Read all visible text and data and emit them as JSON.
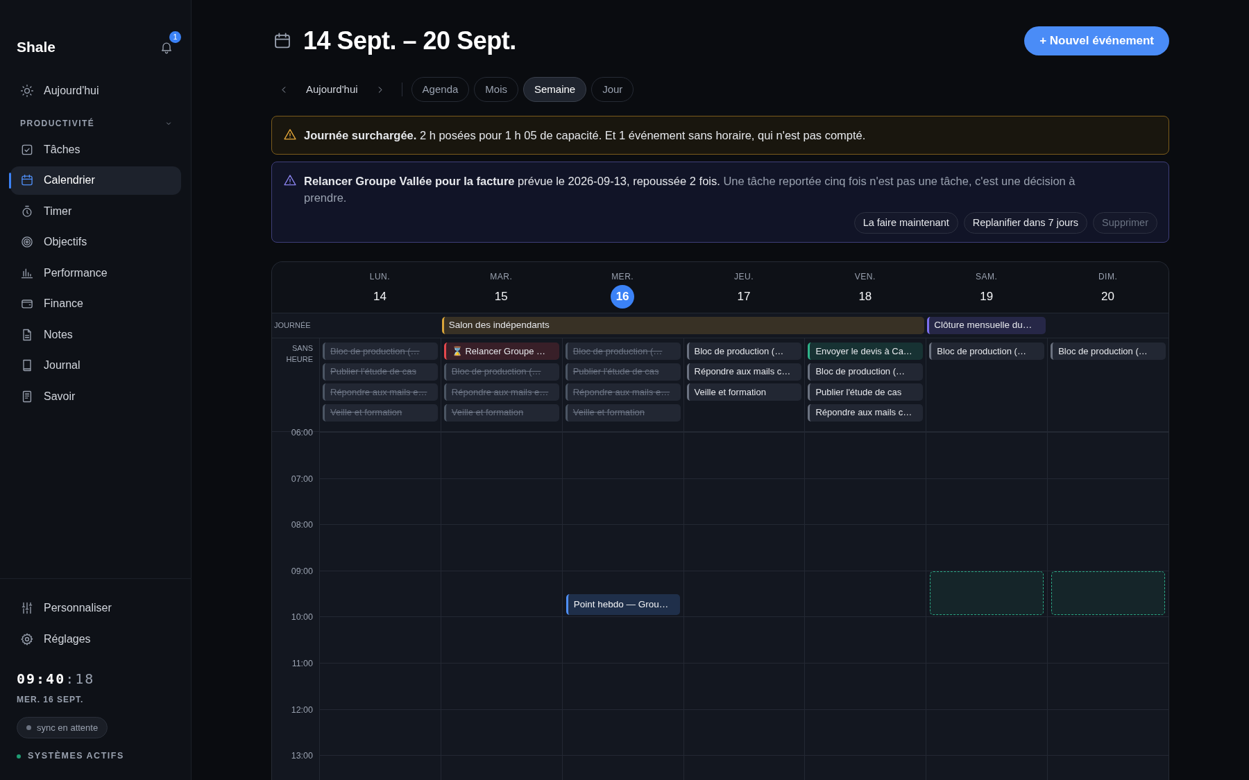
{
  "sidebar": {
    "brand": "Shale",
    "notification_count": "1",
    "top_items": [
      {
        "label": "Aujourd'hui",
        "selected": false
      }
    ],
    "section": {
      "title": "PRODUCTIVITÉ",
      "expanded": true,
      "items": [
        {
          "label": "Tâches",
          "selected": false
        },
        {
          "label": "Calendrier",
          "selected": true
        },
        {
          "label": "Timer",
          "selected": false
        },
        {
          "label": "Objectifs",
          "selected": false
        },
        {
          "label": "Performance",
          "selected": false
        },
        {
          "label": "Finance",
          "selected": false
        },
        {
          "label": "Notes",
          "selected": false
        },
        {
          "label": "Journal",
          "selected": false
        },
        {
          "label": "Savoir",
          "selected": false
        }
      ]
    },
    "footer_items": [
      {
        "label": "Personnaliser"
      },
      {
        "label": "Réglages"
      }
    ],
    "clock": {
      "time": "09:40",
      "seconds": ":18",
      "date": "MER. 16 SEPT."
    },
    "sync": {
      "label": "sync en attente",
      "color": "#6b7280"
    },
    "system": {
      "label": "SYSTÈMES ACTIFS",
      "color": "#1f9d74"
    }
  },
  "header": {
    "title": "14 Sept. – 20 Sept.",
    "new_event_button": "+ Nouvel événement"
  },
  "nav": {
    "today_button": "Aujourd'hui",
    "views": [
      {
        "label": "Agenda",
        "selected": false
      },
      {
        "label": "Mois",
        "selected": false
      },
      {
        "label": "Semaine",
        "selected": true
      },
      {
        "label": "Jour",
        "selected": false
      }
    ]
  },
  "alerts": [
    {
      "kind": "warning",
      "text": "**Journée surchargée.** 2 h posées pour 1 h 05 de capacité. Et 1 événement sans horaire, qui n'est pas compté."
    },
    {
      "kind": "reminder",
      "text": "**Relancer Groupe Vallée pour la facture** prévue le 2026-09-13, repoussée 2 fois.",
      "note": "Une tâche reportée cinq fois n'est pas une tâche, c'est une décision à prendre.",
      "actions": [
        {
          "label": "La faire maintenant",
          "muted": false
        },
        {
          "label": "Replanifier dans 7 jours",
          "muted": false
        },
        {
          "label": "Supprimer",
          "muted": true
        }
      ]
    }
  ],
  "calendar": {
    "allday_label": "JOURNÉE",
    "untimed_label": "SANS HEURE",
    "hours": [
      {
        "label": "06:00"
      },
      {
        "label": "07:00"
      },
      {
        "label": "08:00"
      },
      {
        "label": "09:00",
        "cells": [
          {
            "kind": "empty"
          },
          {
            "kind": "empty"
          },
          {
            "kind": "event",
            "title": "Point hebdo — Grou…",
            "half_past": true,
            "color": "#4f8ff7"
          },
          {
            "kind": "empty"
          },
          {
            "kind": "empty"
          },
          {
            "kind": "free_slot",
            "half_past": false,
            "color": "#2aa784"
          },
          {
            "kind": "free_slot",
            "half_past": false,
            "color": "#2aa784"
          }
        ]
      },
      {
        "label": "10:00"
      },
      {
        "label": "11:00"
      },
      {
        "label": "12:00"
      },
      {
        "label": "13:00"
      }
    ],
    "days": [
      {
        "weekday": "LUN.",
        "date": "14",
        "today": false,
        "untimed": [
          {
            "title": "Bloc de production (…",
            "done": true,
            "color": "#4b5563"
          },
          {
            "title": "Publier l'étude de cas",
            "done": true,
            "color": "#4b5563"
          },
          {
            "title": "Répondre aux mails e…",
            "done": true,
            "color": "#4b5563"
          },
          {
            "title": "Veille et formation",
            "done": true,
            "color": "#4b5563"
          }
        ]
      },
      {
        "weekday": "MAR.",
        "date": "15",
        "today": false,
        "allday": [
          {
            "title": "Salon des indépendants",
            "color": "#d9a53a"
          }
        ],
        "untimed": [
          {
            "title": "⌛ Relancer Groupe …",
            "done": false,
            "color": "#e5484d"
          },
          {
            "title": "Bloc de production (…",
            "done": true,
            "color": "#4b5563"
          },
          {
            "title": "Répondre aux mails e…",
            "done": true,
            "color": "#4b5563"
          },
          {
            "title": "Veille et formation",
            "done": true,
            "color": "#4b5563"
          }
        ]
      },
      {
        "weekday": "MER.",
        "date": "16",
        "today": true,
        "allday_continued": true,
        "untimed": [
          {
            "title": "Bloc de production (…",
            "done": true,
            "color": "#4b5563"
          },
          {
            "title": "Publier l'étude de cas",
            "done": true,
            "color": "#4b5563"
          },
          {
            "title": "Répondre aux mails e…",
            "done": true,
            "color": "#4b5563"
          },
          {
            "title": "Veille et formation",
            "done": true,
            "color": "#4b5563"
          }
        ]
      },
      {
        "weekday": "JEU.",
        "date": "17",
        "today": false,
        "allday_continued": true,
        "untimed": [
          {
            "title": "Bloc de production (…",
            "done": false,
            "color": "#6b7280"
          },
          {
            "title": "Répondre aux mails c…",
            "done": false,
            "color": "#6b7280"
          },
          {
            "title": "Veille et formation",
            "done": false,
            "color": "#6b7280"
          }
        ]
      },
      {
        "weekday": "VEN.",
        "date": "18",
        "today": false,
        "allday_continued": true,
        "untimed": [
          {
            "title": "Envoyer le devis à Ca…",
            "done": false,
            "color": "#2fb38a"
          },
          {
            "title": "Bloc de production (…",
            "done": false,
            "color": "#6b7280"
          },
          {
            "title": "Publier l'étude de cas",
            "done": false,
            "color": "#6b7280"
          },
          {
            "title": "Répondre aux mails c…",
            "done": false,
            "color": "#6b7280"
          }
        ]
      },
      {
        "weekday": "SAM.",
        "date": "19",
        "today": false,
        "allday": [
          {
            "title": "Clôture mensuelle du…",
            "color": "#7c6ff0"
          }
        ],
        "untimed": [
          {
            "title": "Bloc de production (…",
            "done": false,
            "color": "#6b7280"
          }
        ]
      },
      {
        "weekday": "DIM.",
        "date": "20",
        "today": false,
        "untimed": [
          {
            "title": "Bloc de production (…",
            "done": false,
            "color": "#6b7280"
          }
        ]
      }
    ]
  }
}
